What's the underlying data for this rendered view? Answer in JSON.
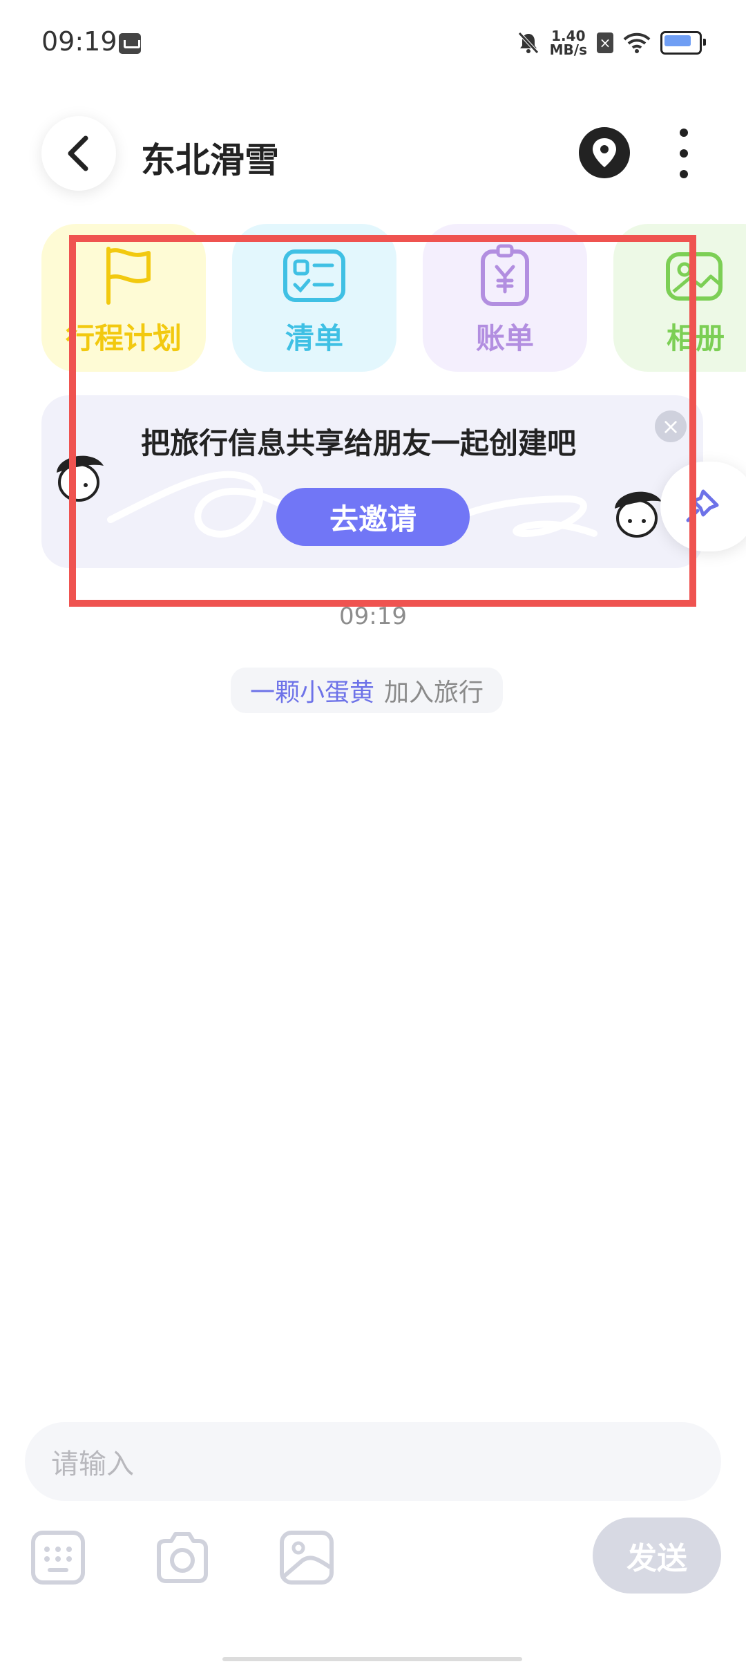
{
  "status_bar": {
    "time": "09:19",
    "net_speed_value": "1.40",
    "net_speed_unit": "MB/s",
    "icons": [
      "mail-icon",
      "mute-bell-icon",
      "sim-x-icon",
      "wifi-icon",
      "battery-icon"
    ]
  },
  "header": {
    "title": "东北滑雪",
    "back_icon": "chevron-left-icon",
    "location_icon": "location-pin-icon",
    "more_icon": "more-vertical-icon"
  },
  "tools": [
    {
      "label": "行程计划",
      "icon": "flag-icon",
      "color": "#f2c90f",
      "bg": "#fefbd5"
    },
    {
      "label": "清单",
      "icon": "checklist-icon",
      "color": "#3fc0e4",
      "bg": "#e3f7fd"
    },
    {
      "label": "账单",
      "icon": "bill-icon",
      "color": "#b28ee0",
      "bg": "#f4effd"
    },
    {
      "label": "相册",
      "icon": "photo-album-icon",
      "color": "#7ccf55",
      "bg": "#edf9e6"
    }
  ],
  "invite_banner": {
    "text": "把旅行信息共享给朋友一起创建吧",
    "button_label": "去邀请",
    "close_symbol": "×",
    "accent": "#7176f6"
  },
  "feed": {
    "time": "09:19",
    "join_event": {
      "user": "一颗小蛋黄",
      "action": "加入旅行"
    }
  },
  "composer": {
    "placeholder": "请输入",
    "send_label": "发送",
    "tools": [
      "keyboard-icon",
      "camera-icon",
      "image-icon"
    ]
  },
  "highlight_color": "#ef5350"
}
